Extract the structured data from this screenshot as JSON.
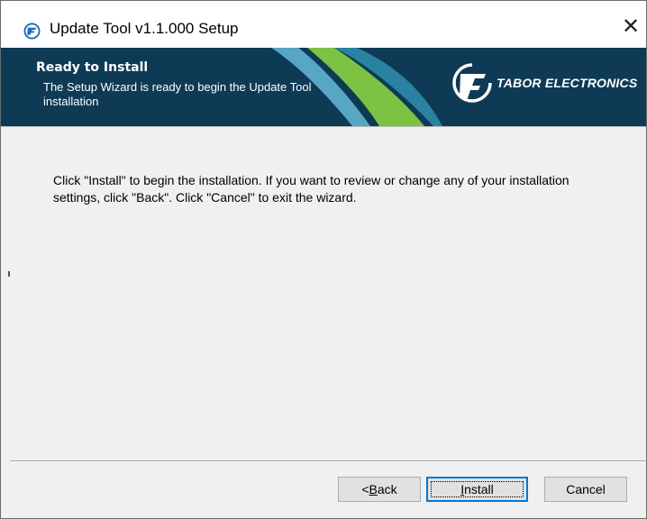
{
  "window": {
    "title": "Update Tool v1.1.000 Setup",
    "close_symbol": "✕",
    "icon": "tabor-app-icon"
  },
  "banner": {
    "heading": "Ready to Install",
    "subtitle": "The Setup Wizard is ready to begin the Update Tool installation",
    "brand_name": "TABOR ELECTRONICS",
    "brand_logo": "tabor-logo-icon",
    "colors": {
      "background": "#0e3a55",
      "accent_green": "#7cc243",
      "accent_light": "#8fd3e8"
    }
  },
  "content": {
    "instructions": "Click \"Install\" to begin the installation.  If you want to review or change any of your installation settings, click \"Back\".  Click \"Cancel\" to exit the wizard."
  },
  "buttons": {
    "back_prefix": "< ",
    "back_mnemonic": "B",
    "back_rest": "ack",
    "install_mnemonic": "I",
    "install_rest": "nstall",
    "cancel": "Cancel"
  }
}
